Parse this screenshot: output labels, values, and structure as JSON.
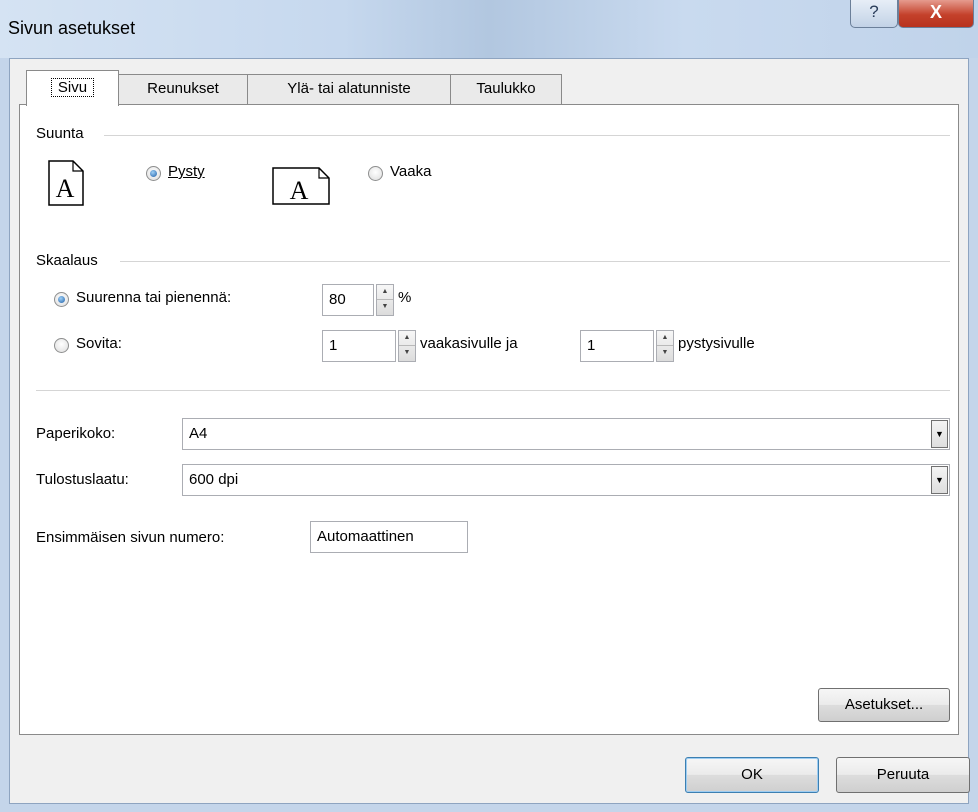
{
  "window": {
    "title": "Sivun asetukset",
    "help_glyph": "?",
    "close_glyph": "X"
  },
  "tabs": [
    {
      "label": "Sivu",
      "active": true
    },
    {
      "label": "Reunukset",
      "active": false
    },
    {
      "label": "Ylä- tai alatunniste",
      "active": false
    },
    {
      "label": "Taulukko",
      "active": false
    }
  ],
  "orientation": {
    "group_label": "Suunta",
    "portrait_label": "Pysty",
    "landscape_label": "Vaaka",
    "selected": "portrait",
    "icon_letter": "A"
  },
  "scaling": {
    "group_label": "Skaalaus",
    "adjust_label": "Suurenna tai pienennä:",
    "adjust_value": "80",
    "percent_sign": "%",
    "fit_label": "Sovita:",
    "fit_wide_value": "1",
    "fit_wide_suffix": "vaakasivulle ja",
    "fit_tall_value": "1",
    "fit_tall_suffix": "pystysivulle",
    "selected": "adjust"
  },
  "paper": {
    "size_label": "Paperikoko:",
    "size_value": "A4",
    "quality_label": "Tulostuslaatu:",
    "quality_value": "600 dpi",
    "first_page_label": "Ensimmäisen sivun numero:",
    "first_page_value": "Automaattinen"
  },
  "buttons": {
    "options": "Asetukset...",
    "ok": "OK",
    "cancel": "Peruuta"
  },
  "icons": {
    "spin_up": "▲",
    "spin_down": "▼",
    "dropdown": "▼"
  }
}
